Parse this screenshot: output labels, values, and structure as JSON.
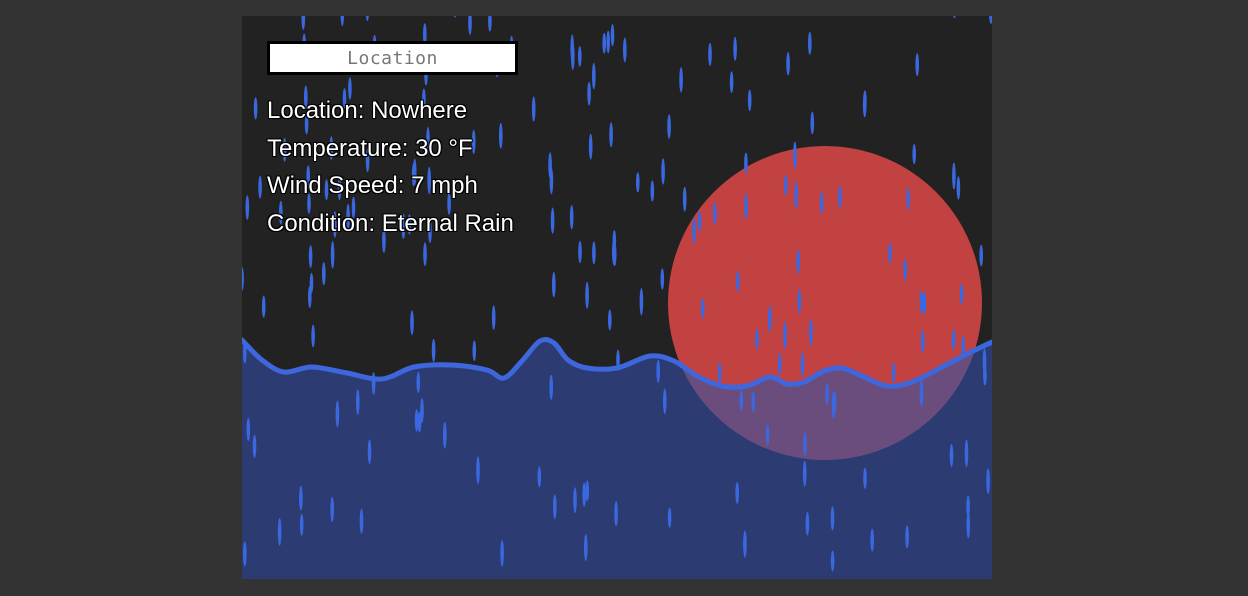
{
  "search": {
    "placeholder": "Location",
    "value": ""
  },
  "weather": {
    "location_label": "Location: Nowhere",
    "temperature_label": "Temperature: 30 °F",
    "wind_label": "Wind Speed: 7 mph",
    "condition_label": "Condition: Eternal Rain"
  },
  "colors": {
    "page_background": "#333333",
    "sky": "#222222",
    "sun": "#c24242",
    "sun_underwater": "#6b4d7d",
    "sea": "#2c3c72",
    "wave_line": "#3e66dd",
    "rain": "#3a68e0"
  },
  "scene": {
    "sun-icon": "sun",
    "rain-icon": "raindrops",
    "wave-icon": "sea-waves"
  }
}
